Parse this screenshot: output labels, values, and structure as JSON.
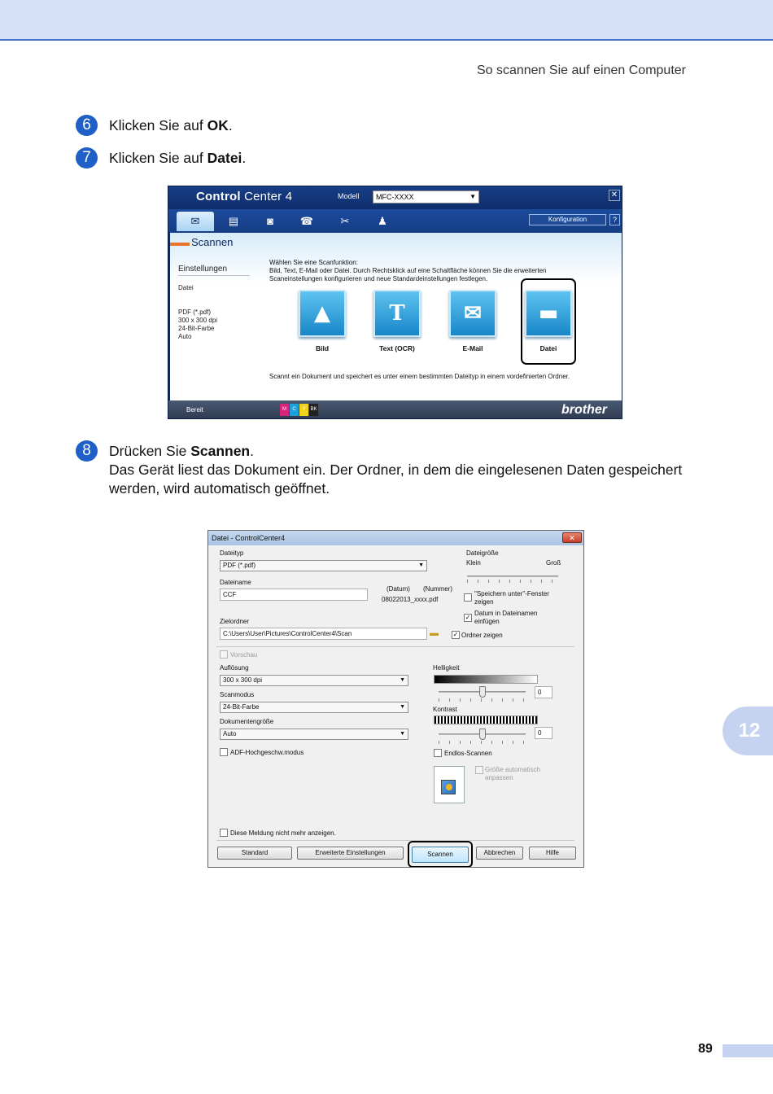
{
  "header": {
    "running_title": "So scannen Sie auf einen Computer"
  },
  "steps": [
    {
      "number": "6",
      "before": "Klicken Sie auf ",
      "bold": "OK",
      "after": "."
    },
    {
      "number": "7",
      "before": "Klicken Sie auf ",
      "bold": "Datei",
      "after": "."
    },
    {
      "number": "8",
      "before": "Drücken Sie ",
      "bold": "Scannen",
      "after": ".",
      "line2": "Das Gerät liest das Dokument ein. Der Ordner, in dem die eingelesenen Daten gespeichert",
      "line3": "werden, wird automatisch geöffnet."
    }
  ],
  "cc4": {
    "logo_bold": "Control",
    "logo_rest": " Center 4",
    "model_label": "Modell",
    "model_value": "MFC-XXXX",
    "close": "✕",
    "tabs": [
      "✉",
      "▤",
      "◙",
      "☎",
      "✂",
      "♟"
    ],
    "konfiguration": "Konfiguration",
    "help": "?",
    "section": "Scannen",
    "left_heading": "Einstellungen",
    "left_type": "Datei",
    "left_details": [
      "PDF (*.pdf)",
      "300 x 300 dpi",
      "24-Bit-Farbe",
      "Auto"
    ],
    "intro_lines": [
      "Wählen Sie eine Scanfunktion:",
      "Bild, Text, E-Mail oder Datei. Durch Rechtsklick auf eine Schaltfläche können Sie die erweiterten",
      "Scaneinstellungen konfigurieren und neue Standardeinstellungen festlegen."
    ],
    "buttons": [
      {
        "label": "Bild",
        "glyph": "▲"
      },
      {
        "label": "Text (OCR)",
        "glyph": "T"
      },
      {
        "label": "E-Mail",
        "glyph": "✉"
      },
      {
        "label": "Datei",
        "glyph": "▬"
      }
    ],
    "description": "Scannt ein Dokument und speichert es unter einem bestimmten Dateityp in einem vordefinierten Ordner.",
    "status": "Bereit",
    "ink": [
      "M",
      "C",
      "Y",
      "BK"
    ],
    "ink_colors": [
      "#d6247c",
      "#1aa1dc",
      "#f3d21b",
      "#222222"
    ],
    "brand": "brother"
  },
  "dialog": {
    "title": "Datei - ControlCenter4",
    "close": "✕",
    "dateityp_label": "Dateityp",
    "dateityp_value": "PDF (*.pdf)",
    "dateigroesse_label": "Dateigröße",
    "klein": "Klein",
    "gross": "Groß",
    "dateiname_label": "Dateiname",
    "dateiname_value": "CCF",
    "datum_label": "(Datum)",
    "nummer_label": "(Nummer)",
    "filename_example": "08022013_xxxx.pdf",
    "speichern_line1": "\"Speichern unter\"-Fenster",
    "speichern_line2": "zeigen",
    "datum_einfuegen_line1": "Datum in Dateinamen",
    "datum_einfuegen_line2": "einfügen",
    "zielordner_label": "Zielordner",
    "zielordner_value": "C:\\Users\\User\\Pictures\\ControlCenter4\\Scan",
    "ordner_zeigen": "Ordner zeigen",
    "vorschau": "Vorschau",
    "aufloesung_label": "Auflösung",
    "aufloesung_value": "300 x 300 dpi",
    "scanmodus_label": "Scanmodus",
    "scanmodus_value": "24-Bit-Farbe",
    "dokgroesse_label": "Dokumentengröße",
    "dokgroesse_value": "Auto",
    "adf": "ADF-Hochgeschw.modus",
    "helligkeit_label": "Helligkeit",
    "helligkeit_value": "0",
    "helligkeit_level": 0,
    "kontrast_label": "Kontrast",
    "kontrast_value": "0",
    "kontrast_level": 0,
    "endlos": "Endlos-Scannen",
    "groesse_auto_line1": "Größe automatisch",
    "groesse_auto_line2": "anpassen",
    "meldung": "Diese Meldung nicht mehr anzeigen.",
    "btn_standard": "Standard",
    "btn_erweitert": "Erweiterte Einstellungen",
    "btn_scannen": "Scannen",
    "btn_abbrechen": "Abbrechen",
    "btn_hilfe": "Hilfe"
  },
  "chapter": "12",
  "page_number": "89"
}
